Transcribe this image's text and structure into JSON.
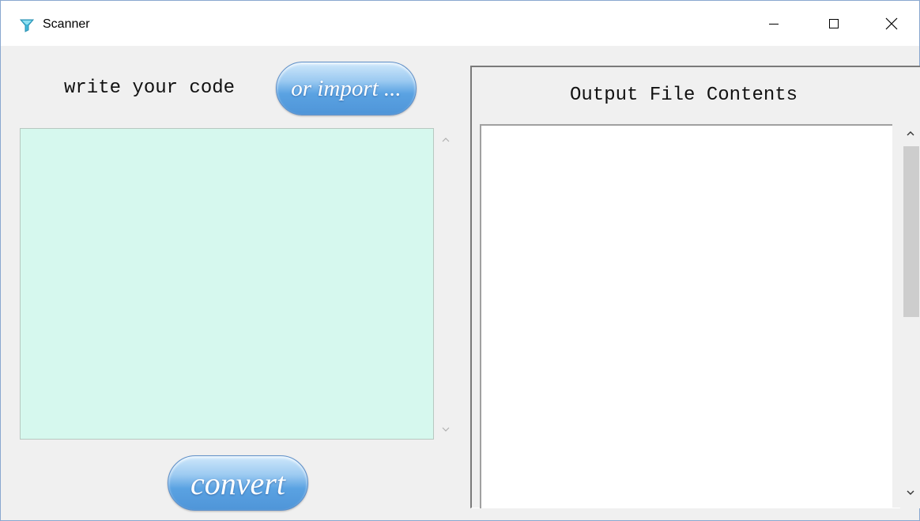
{
  "window": {
    "title": "Scanner",
    "controls": {
      "minimize": "minimize-icon",
      "maximize": "maximize-icon",
      "close": "close-icon"
    }
  },
  "left_panel": {
    "label": "write your code",
    "import_button": "or import ...",
    "code_text": "",
    "convert_button": "convert"
  },
  "right_panel": {
    "label": "Output File Contents",
    "output_text": ""
  },
  "colors": {
    "code_background": "#d6f8ee",
    "button_blue": "#5aa2e2",
    "window_border": "#8aa8cf"
  }
}
